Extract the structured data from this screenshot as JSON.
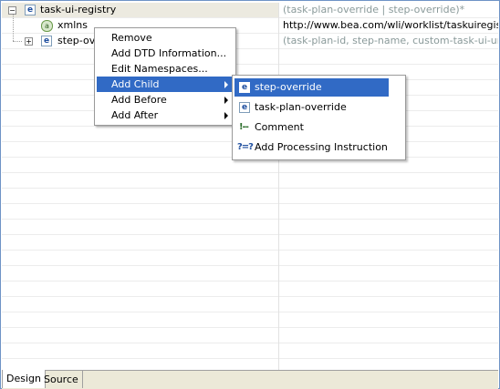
{
  "tree": {
    "rows": [
      {
        "name": "task-ui-registry",
        "value": "(task-plan-override | step-override)*",
        "icon": "element-icon",
        "expanded": true
      },
      {
        "name": "xmlns",
        "value": "http://www.bea.com/wli/worklist/taskuiregistry",
        "icon": "attribute-icon"
      },
      {
        "name": "step-ove",
        "value": "(task-plan-id, step-name, custom-task-ui-uri)",
        "icon": "element-icon",
        "expanded": false
      }
    ]
  },
  "context_menu": {
    "items": [
      {
        "label": "Remove"
      },
      {
        "label": "Add DTD Information..."
      },
      {
        "label": "Edit Namespaces..."
      },
      {
        "label": "Add Child",
        "submenu": true,
        "highlighted": true
      },
      {
        "label": "Add Before",
        "submenu": true
      },
      {
        "label": "Add After",
        "submenu": true
      }
    ]
  },
  "submenu": {
    "items": [
      {
        "label": "step-override",
        "icon": "element-icon",
        "highlighted": true
      },
      {
        "label": "task-plan-override",
        "icon": "element-icon"
      },
      {
        "label": "Comment",
        "icon": "comment-icon"
      },
      {
        "label": "Add Processing Instruction",
        "icon": "processing-instruction-icon"
      }
    ]
  },
  "tabs": [
    {
      "label": "Design",
      "active": true
    },
    {
      "label": "Source",
      "active": false
    }
  ],
  "icons": {
    "element_glyph": "e",
    "attribute_glyph": "a",
    "expand_glyph": "+",
    "collapse_glyph": "−",
    "comment_glyph": "!--",
    "pi_glyph": "?=?"
  },
  "colors": {
    "highlight": "#316ac5",
    "muted_value": "#8a9a9a",
    "selected_row": "#eceae0"
  }
}
